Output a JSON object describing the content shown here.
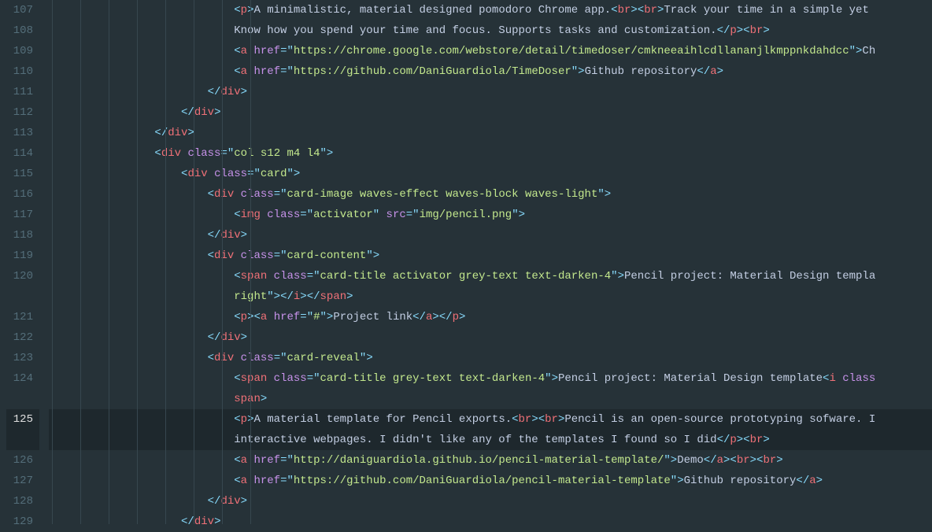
{
  "lineNumbers": [
    "107",
    "108",
    "109",
    "110",
    "111",
    "112",
    "113",
    "114",
    "115",
    "116",
    "117",
    "118",
    "119",
    "120",
    "",
    "121",
    "122",
    "123",
    "124",
    "",
    "125",
    "",
    "126",
    "127",
    "128",
    "129"
  ],
  "currentLine": "125",
  "indentGuides": [
    8,
    44,
    80,
    116,
    152,
    188,
    224,
    260
  ],
  "lines": [
    {
      "indent": 7,
      "tokens": [
        {
          "c": "p",
          "v": "<"
        },
        {
          "c": "t",
          "v": "p"
        },
        {
          "c": "p",
          "v": ">"
        },
        {
          "c": "x",
          "v": "A minimalistic, material designed pomodoro Chrome app."
        },
        {
          "c": "p",
          "v": "<"
        },
        {
          "c": "t",
          "v": "br"
        },
        {
          "c": "p",
          "v": "><"
        },
        {
          "c": "t",
          "v": "br"
        },
        {
          "c": "p",
          "v": ">"
        },
        {
          "c": "x",
          "v": "Track your time in a simple yet "
        }
      ]
    },
    {
      "indent": 7,
      "tokens": [
        {
          "c": "x",
          "v": "Know how you spend your time and focus. Supports tasks and customization."
        },
        {
          "c": "p",
          "v": "</"
        },
        {
          "c": "t",
          "v": "p"
        },
        {
          "c": "p",
          "v": "><"
        },
        {
          "c": "t",
          "v": "br"
        },
        {
          "c": "p",
          "v": ">"
        }
      ]
    },
    {
      "indent": 7,
      "tokens": [
        {
          "c": "p",
          "v": "<"
        },
        {
          "c": "t",
          "v": "a"
        },
        {
          "c": "w",
          "v": " "
        },
        {
          "c": "a",
          "v": "href"
        },
        {
          "c": "p",
          "v": "="
        },
        {
          "c": "p",
          "v": "\""
        },
        {
          "c": "s",
          "v": "https://chrome.google.com/webstore/detail/timedoser/cmkneeaihlcdllananjlkmppnkdahdcc"
        },
        {
          "c": "p",
          "v": "\""
        },
        {
          "c": "p",
          "v": ">"
        },
        {
          "c": "x",
          "v": "Ch"
        }
      ]
    },
    {
      "indent": 7,
      "tokens": [
        {
          "c": "p",
          "v": "<"
        },
        {
          "c": "t",
          "v": "a"
        },
        {
          "c": "w",
          "v": " "
        },
        {
          "c": "a",
          "v": "href"
        },
        {
          "c": "p",
          "v": "="
        },
        {
          "c": "p",
          "v": "\""
        },
        {
          "c": "s",
          "v": "https://github.com/DaniGuardiola/TimeDoser"
        },
        {
          "c": "p",
          "v": "\""
        },
        {
          "c": "p",
          "v": ">"
        },
        {
          "c": "x",
          "v": "Github repository"
        },
        {
          "c": "p",
          "v": "</"
        },
        {
          "c": "t",
          "v": "a"
        },
        {
          "c": "p",
          "v": ">"
        }
      ]
    },
    {
      "indent": 6,
      "tokens": [
        {
          "c": "p",
          "v": "</"
        },
        {
          "c": "t",
          "v": "div"
        },
        {
          "c": "p",
          "v": ">"
        }
      ]
    },
    {
      "indent": 5,
      "tokens": [
        {
          "c": "p",
          "v": "</"
        },
        {
          "c": "t",
          "v": "div"
        },
        {
          "c": "p",
          "v": ">"
        }
      ]
    },
    {
      "indent": 4,
      "tokens": [
        {
          "c": "p",
          "v": "</"
        },
        {
          "c": "t",
          "v": "div"
        },
        {
          "c": "p",
          "v": ">"
        }
      ]
    },
    {
      "indent": 4,
      "tokens": [
        {
          "c": "p",
          "v": "<"
        },
        {
          "c": "t",
          "v": "div"
        },
        {
          "c": "w",
          "v": " "
        },
        {
          "c": "a",
          "v": "class"
        },
        {
          "c": "p",
          "v": "="
        },
        {
          "c": "p",
          "v": "\""
        },
        {
          "c": "s",
          "v": "col s12 m4 l4"
        },
        {
          "c": "p",
          "v": "\""
        },
        {
          "c": "p",
          "v": ">"
        }
      ]
    },
    {
      "indent": 5,
      "tokens": [
        {
          "c": "p",
          "v": "<"
        },
        {
          "c": "t",
          "v": "div"
        },
        {
          "c": "w",
          "v": " "
        },
        {
          "c": "a",
          "v": "class"
        },
        {
          "c": "p",
          "v": "="
        },
        {
          "c": "p",
          "v": "\""
        },
        {
          "c": "s",
          "v": "card"
        },
        {
          "c": "p",
          "v": "\""
        },
        {
          "c": "p",
          "v": ">"
        }
      ]
    },
    {
      "indent": 6,
      "tokens": [
        {
          "c": "p",
          "v": "<"
        },
        {
          "c": "t",
          "v": "div"
        },
        {
          "c": "w",
          "v": " "
        },
        {
          "c": "a",
          "v": "class"
        },
        {
          "c": "p",
          "v": "="
        },
        {
          "c": "p",
          "v": "\""
        },
        {
          "c": "s",
          "v": "card-image waves-effect waves-block waves-light"
        },
        {
          "c": "p",
          "v": "\""
        },
        {
          "c": "p",
          "v": ">"
        }
      ]
    },
    {
      "indent": 7,
      "tokens": [
        {
          "c": "p",
          "v": "<"
        },
        {
          "c": "t",
          "v": "img"
        },
        {
          "c": "w",
          "v": " "
        },
        {
          "c": "a",
          "v": "class"
        },
        {
          "c": "p",
          "v": "="
        },
        {
          "c": "p",
          "v": "\""
        },
        {
          "c": "s",
          "v": "activator"
        },
        {
          "c": "p",
          "v": "\""
        },
        {
          "c": "w",
          "v": " "
        },
        {
          "c": "a",
          "v": "src"
        },
        {
          "c": "p",
          "v": "="
        },
        {
          "c": "p",
          "v": "\""
        },
        {
          "c": "s",
          "v": "img/pencil.png"
        },
        {
          "c": "p",
          "v": "\""
        },
        {
          "c": "p",
          "v": ">"
        }
      ]
    },
    {
      "indent": 6,
      "tokens": [
        {
          "c": "p",
          "v": "</"
        },
        {
          "c": "t",
          "v": "div"
        },
        {
          "c": "p",
          "v": ">"
        }
      ]
    },
    {
      "indent": 6,
      "tokens": [
        {
          "c": "p",
          "v": "<"
        },
        {
          "c": "t",
          "v": "div"
        },
        {
          "c": "w",
          "v": " "
        },
        {
          "c": "a",
          "v": "class"
        },
        {
          "c": "p",
          "v": "="
        },
        {
          "c": "p",
          "v": "\""
        },
        {
          "c": "s",
          "v": "card-content"
        },
        {
          "c": "p",
          "v": "\""
        },
        {
          "c": "p",
          "v": ">"
        }
      ]
    },
    {
      "indent": 7,
      "tokens": [
        {
          "c": "p",
          "v": "<"
        },
        {
          "c": "t",
          "v": "span"
        },
        {
          "c": "w",
          "v": " "
        },
        {
          "c": "a",
          "v": "class"
        },
        {
          "c": "p",
          "v": "="
        },
        {
          "c": "p",
          "v": "\""
        },
        {
          "c": "s",
          "v": "card-title activator grey-text text-darken-4"
        },
        {
          "c": "p",
          "v": "\""
        },
        {
          "c": "p",
          "v": ">"
        },
        {
          "c": "x",
          "v": "Pencil project: Material Design templa"
        }
      ]
    },
    {
      "indent": 7,
      "tokens": [
        {
          "c": "s",
          "v": "right"
        },
        {
          "c": "p",
          "v": "\""
        },
        {
          "c": "p",
          "v": "></"
        },
        {
          "c": "t",
          "v": "i"
        },
        {
          "c": "p",
          "v": "></"
        },
        {
          "c": "t",
          "v": "span"
        },
        {
          "c": "p",
          "v": ">"
        }
      ]
    },
    {
      "indent": 7,
      "tokens": [
        {
          "c": "p",
          "v": "<"
        },
        {
          "c": "t",
          "v": "p"
        },
        {
          "c": "p",
          "v": "><"
        },
        {
          "c": "t",
          "v": "a"
        },
        {
          "c": "w",
          "v": " "
        },
        {
          "c": "a",
          "v": "href"
        },
        {
          "c": "p",
          "v": "="
        },
        {
          "c": "p",
          "v": "\""
        },
        {
          "c": "s",
          "v": "#"
        },
        {
          "c": "p",
          "v": "\""
        },
        {
          "c": "p",
          "v": ">"
        },
        {
          "c": "x",
          "v": "Project link"
        },
        {
          "c": "p",
          "v": "</"
        },
        {
          "c": "t",
          "v": "a"
        },
        {
          "c": "p",
          "v": "></"
        },
        {
          "c": "t",
          "v": "p"
        },
        {
          "c": "p",
          "v": ">"
        }
      ]
    },
    {
      "indent": 6,
      "tokens": [
        {
          "c": "p",
          "v": "</"
        },
        {
          "c": "t",
          "v": "div"
        },
        {
          "c": "p",
          "v": ">"
        }
      ]
    },
    {
      "indent": 6,
      "tokens": [
        {
          "c": "p",
          "v": "<"
        },
        {
          "c": "t",
          "v": "div"
        },
        {
          "c": "w",
          "v": " "
        },
        {
          "c": "a",
          "v": "class"
        },
        {
          "c": "p",
          "v": "="
        },
        {
          "c": "p",
          "v": "\""
        },
        {
          "c": "s",
          "v": "card-reveal"
        },
        {
          "c": "p",
          "v": "\""
        },
        {
          "c": "p",
          "v": ">"
        }
      ]
    },
    {
      "indent": 7,
      "tokens": [
        {
          "c": "p",
          "v": "<"
        },
        {
          "c": "t",
          "v": "span"
        },
        {
          "c": "w",
          "v": " "
        },
        {
          "c": "a",
          "v": "class"
        },
        {
          "c": "p",
          "v": "="
        },
        {
          "c": "p",
          "v": "\""
        },
        {
          "c": "s",
          "v": "card-title grey-text text-darken-4"
        },
        {
          "c": "p",
          "v": "\""
        },
        {
          "c": "p",
          "v": ">"
        },
        {
          "c": "x",
          "v": "Pencil project: Material Design template"
        },
        {
          "c": "p",
          "v": "<"
        },
        {
          "c": "t",
          "v": "i"
        },
        {
          "c": "w",
          "v": " "
        },
        {
          "c": "a",
          "v": "class"
        }
      ]
    },
    {
      "indent": 7,
      "tokens": [
        {
          "c": "t",
          "v": "span"
        },
        {
          "c": "p",
          "v": ">"
        }
      ]
    },
    {
      "indent": 7,
      "tokens": [
        {
          "c": "p",
          "v": "<"
        },
        {
          "c": "t",
          "v": "p"
        },
        {
          "c": "p",
          "v": ">"
        },
        {
          "c": "x",
          "v": "A material template for Pencil exports."
        },
        {
          "c": "p",
          "v": "<"
        },
        {
          "c": "t",
          "v": "br"
        },
        {
          "c": "p",
          "v": "><"
        },
        {
          "c": "t",
          "v": "br"
        },
        {
          "c": "p",
          "v": ">"
        },
        {
          "c": "x",
          "v": "Pencil is an open-source prototyping sofware. I"
        }
      ]
    },
    {
      "indent": 7,
      "tokens": [
        {
          "c": "x",
          "v": "interactive webpages. I didn't like any of the templates I found so I did"
        },
        {
          "c": "p",
          "v": "</"
        },
        {
          "c": "t",
          "v": "p"
        },
        {
          "c": "p",
          "v": "><"
        },
        {
          "c": "t",
          "v": "br"
        },
        {
          "c": "p",
          "v": ">"
        }
      ]
    },
    {
      "indent": 7,
      "tokens": [
        {
          "c": "p",
          "v": "<"
        },
        {
          "c": "t",
          "v": "a"
        },
        {
          "c": "w",
          "v": " "
        },
        {
          "c": "a",
          "v": "href"
        },
        {
          "c": "p",
          "v": "="
        },
        {
          "c": "p",
          "v": "\""
        },
        {
          "c": "s",
          "v": "http://daniguardiola.github.io/pencil-material-template/"
        },
        {
          "c": "p",
          "v": "\""
        },
        {
          "c": "p",
          "v": ">"
        },
        {
          "c": "x",
          "v": "Demo"
        },
        {
          "c": "p",
          "v": "</"
        },
        {
          "c": "t",
          "v": "a"
        },
        {
          "c": "p",
          "v": "><"
        },
        {
          "c": "t",
          "v": "br"
        },
        {
          "c": "p",
          "v": "><"
        },
        {
          "c": "t",
          "v": "br"
        },
        {
          "c": "p",
          "v": ">"
        }
      ]
    },
    {
      "indent": 7,
      "tokens": [
        {
          "c": "p",
          "v": "<"
        },
        {
          "c": "t",
          "v": "a"
        },
        {
          "c": "w",
          "v": " "
        },
        {
          "c": "a",
          "v": "href"
        },
        {
          "c": "p",
          "v": "="
        },
        {
          "c": "p",
          "v": "\""
        },
        {
          "c": "s",
          "v": "https://github.com/DaniGuardiola/pencil-material-template"
        },
        {
          "c": "p",
          "v": "\""
        },
        {
          "c": "p",
          "v": ">"
        },
        {
          "c": "x",
          "v": "Github repository"
        },
        {
          "c": "p",
          "v": "</"
        },
        {
          "c": "t",
          "v": "a"
        },
        {
          "c": "p",
          "v": ">"
        }
      ]
    },
    {
      "indent": 6,
      "tokens": [
        {
          "c": "p",
          "v": "</"
        },
        {
          "c": "t",
          "v": "div"
        },
        {
          "c": "p",
          "v": ">"
        }
      ]
    },
    {
      "indent": 5,
      "tokens": [
        {
          "c": "p",
          "v": "</"
        },
        {
          "c": "t",
          "v": "div"
        },
        {
          "c": "p",
          "v": ">"
        }
      ]
    }
  ]
}
